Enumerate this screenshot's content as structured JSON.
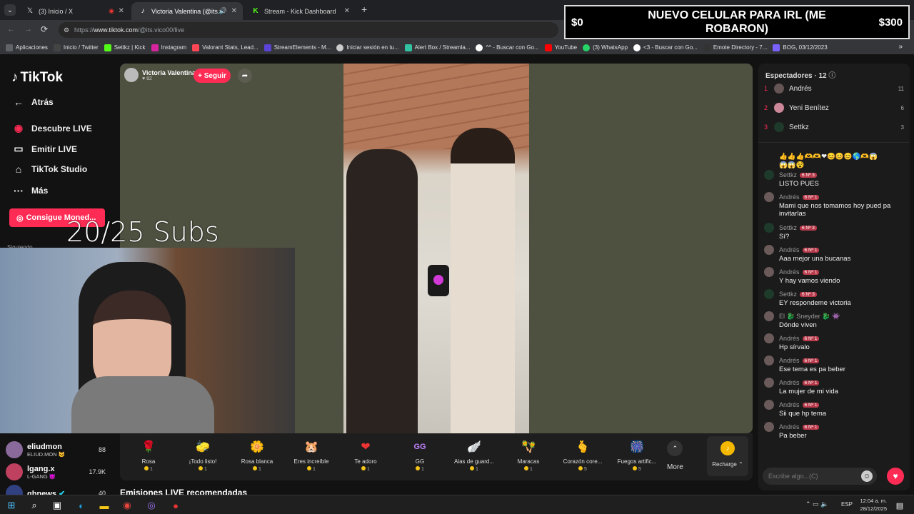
{
  "browser": {
    "tabs": [
      {
        "label": "(3) Inicio / X",
        "icon": "x-logo-icon"
      },
      {
        "label": "Victoria Valentina (@its.vico",
        "icon": "tiktok-icon",
        "active": true
      },
      {
        "label": "Stream - Kick Dashboard",
        "icon": "kick-icon"
      }
    ],
    "url_prefix": "https://",
    "url_domain": "www.tiktok.com",
    "url_path": "/@its.vico00/live",
    "bookmarks": [
      "Aplicaciones",
      "Inicio / Twitter",
      "Settkz | Kick",
      "Instagram",
      "Valorant Stats, Lead...",
      "StreamElements - M...",
      "Iniciar sesión en tu...",
      "Alert Box / Streamla...",
      "^^ - Buscar con Go...",
      "YouTube",
      "(3) WhatsApp",
      "<3 - Buscar con Go...",
      "Emote Directory - 7...",
      "BOG, 03/12/2023"
    ]
  },
  "banner": {
    "left": "$0",
    "title": "NUEVO CELULAR PARA IRL (ME ROBARON)",
    "right": "$300"
  },
  "overlay": {
    "subs": "20/25 Subs"
  },
  "sidebar": {
    "logo": "TikTok",
    "items": [
      {
        "label": "Atrás"
      },
      {
        "label": "Descubre LIVE"
      },
      {
        "label": "Emitir LIVE"
      },
      {
        "label": "TikTok Studio"
      },
      {
        "label": "Más"
      }
    ],
    "coins_button": "Consigue Moned...",
    "following_label": "Siguiendo",
    "live_list": [
      {
        "name": "eliudmon",
        "sub": "ELIUD.MON 😼",
        "count": "88"
      },
      {
        "name": "lgang.x",
        "sub": "L-GANG 😈",
        "count": "17.9K"
      },
      {
        "name": "gbnews",
        "sub": "",
        "count": "40"
      }
    ]
  },
  "stream": {
    "host": "Victoria Valentina",
    "likes": "82",
    "follow_button": "+ Seguir",
    "recommended_title": "Emisiones LIVE recomendadas"
  },
  "gifts": [
    {
      "name": "Rosa",
      "price": "1",
      "icon": "🌹"
    },
    {
      "name": "¡Todo listo!",
      "price": "1",
      "icon": "🧽"
    },
    {
      "name": "Rosa blanca",
      "price": "1",
      "icon": "🌼"
    },
    {
      "name": "Eres increíble",
      "price": "1",
      "icon": "🐹"
    },
    {
      "name": "Te adoro",
      "price": "1",
      "icon": "❤"
    },
    {
      "name": "GG",
      "price": "1",
      "icon": "GG"
    },
    {
      "name": "Alas de guard...",
      "price": "1",
      "icon": "🪽"
    },
    {
      "name": "Maracas",
      "price": "1",
      "icon": "🪇"
    },
    {
      "name": "Corazón core...",
      "price": "5",
      "icon": "🫰"
    },
    {
      "name": "Fuegos artific...",
      "price": "5",
      "icon": "🎆"
    }
  ],
  "gift_more": "More",
  "recharge": "Recharge",
  "viewers": {
    "title": "Espectadores",
    "count": "12",
    "list": [
      {
        "rank": "1",
        "name": "Andrés",
        "score": "11"
      },
      {
        "rank": "2",
        "name": "Yeni Benítez",
        "score": "6"
      },
      {
        "rank": "3",
        "name": "Settkz",
        "score": "3"
      }
    ]
  },
  "chat": [
    {
      "user": "",
      "badge": "",
      "text": "👍👍👍🫶🫶❤😊😊😊🌎🫶😱"
    },
    {
      "user": "",
      "badge": "",
      "text": "😱😱😵"
    },
    {
      "user": "Settkz",
      "badge": "6 Nº 3",
      "text": "LISTO PUES"
    },
    {
      "user": "Andrés",
      "badge": "6 Nº 1",
      "text": "Mami que nos tomamos hoy pued pa invitarlas"
    },
    {
      "user": "Settkz",
      "badge": "6 Nº 3",
      "text": "Sí?"
    },
    {
      "user": "Andrés",
      "badge": "6 Nº 1",
      "text": "Aaa mejor una bucanas"
    },
    {
      "user": "Andrés",
      "badge": "6 Nº 1",
      "text": "Y hay vamos viendo"
    },
    {
      "user": "Settkz",
      "badge": "6 Nº 3",
      "text": "EY respondeme victoria"
    },
    {
      "user": "El 🐉 Sneyder 🐉 👾",
      "badge": "",
      "text": "Dónde viven"
    },
    {
      "user": "Andrés",
      "badge": "6 Nº 1",
      "text": "Hp sírvalo"
    },
    {
      "user": "Andrés",
      "badge": "6 Nº 1",
      "text": "Ese tema es pa beber"
    },
    {
      "user": "Andrés",
      "badge": "6 Nº 1",
      "text": "La mujer de mi vida"
    },
    {
      "user": "Andrés",
      "badge": "6 Nº 1",
      "text": "Sii que hp tema"
    },
    {
      "user": "Andrés",
      "badge": "6 Nº 1",
      "text": "Pa beber"
    }
  ],
  "chat_input": {
    "placeholder": "Escribe algo...(C)"
  },
  "taskbar": {
    "lang": "ESP",
    "time": "12:04 a. m.",
    "date": "28/12/2025"
  }
}
